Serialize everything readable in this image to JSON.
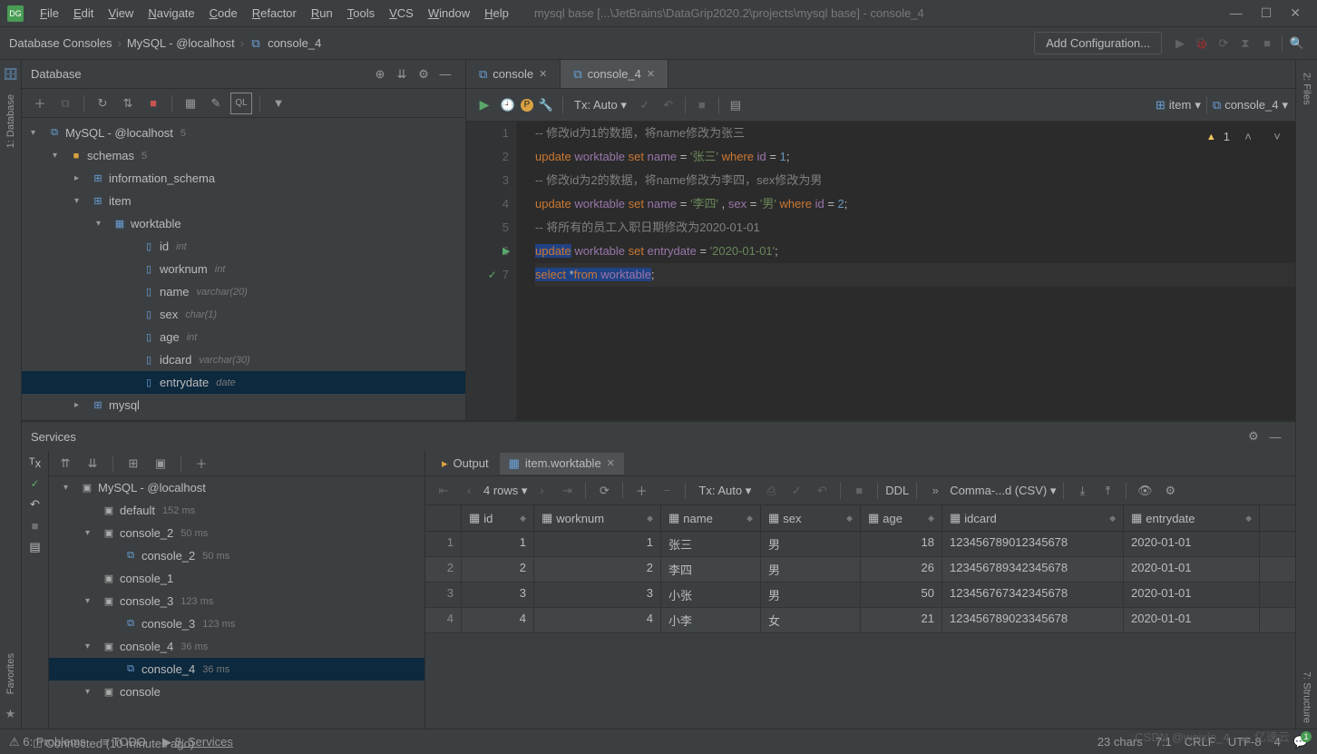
{
  "app_icon": "DG",
  "menu": [
    "File",
    "Edit",
    "View",
    "Navigate",
    "Code",
    "Refactor",
    "Run",
    "Tools",
    "VCS",
    "Window",
    "Help"
  ],
  "title_path": "mysql base [...\\JetBrains\\DataGrip2020.2\\projects\\mysql base] - console_4",
  "breadcrumb": [
    "Database Consoles",
    "MySQL - @localhost",
    "console_4"
  ],
  "config_button": "Add Configuration...",
  "db_panel": {
    "title": "Database"
  },
  "tree": {
    "root": {
      "label": "MySQL - @localhost",
      "badge": "5"
    },
    "schemas": {
      "label": "schemas",
      "badge": "5"
    },
    "info_schema": "information_schema",
    "item": "item",
    "worktable": "worktable",
    "columns": [
      {
        "name": "id",
        "type": "int"
      },
      {
        "name": "worknum",
        "type": "int"
      },
      {
        "name": "name",
        "type": "varchar(20)"
      },
      {
        "name": "sex",
        "type": "char(1)"
      },
      {
        "name": "age",
        "type": "int"
      },
      {
        "name": "idcard",
        "type": "varchar(30)"
      },
      {
        "name": "entrydate",
        "type": "date"
      }
    ],
    "mysql": "mysql"
  },
  "tabs": [
    {
      "label": "console"
    },
    {
      "label": "console_4",
      "active": true
    }
  ],
  "editor_toolbar": {
    "tx": "Tx: Auto",
    "item": "item",
    "console": "console_4"
  },
  "code_lines": [
    {
      "n": 1,
      "html": "<span class='c-comment'>-- 修改id为1的数据，将name修改为张三</span>"
    },
    {
      "n": 2,
      "html": "<span class='c-kw'>update</span> <span class='c-id'>worktable</span> <span class='c-kw'>set</span> <span class='c-id'>name</span> <span class='c-op'>=</span> <span class='c-str'>'张三'</span> <span class='c-kw'>where</span> <span class='c-id'>id</span> <span class='c-op'>=</span> <span class='c-num'>1</span><span class='c-op'>;</span>"
    },
    {
      "n": 3,
      "html": "<span class='c-comment'>-- 修改id为2的数据，将name修改为李四，sex修改为男</span>"
    },
    {
      "n": 4,
      "html": "<span class='c-kw'>update</span> <span class='c-id'>worktable</span> <span class='c-kw'>set</span> <span class='c-id'>name</span> <span class='c-op'>=</span> <span class='c-str'>'李四'</span> <span class='c-op'>,</span> <span class='c-id'>sex</span> <span class='c-op'>=</span> <span class='c-str'>'男'</span> <span class='c-kw'>where</span> <span class='c-id'>id</span> <span class='c-op'>=</span> <span class='c-num'>2</span><span class='c-op'>;</span>"
    },
    {
      "n": 5,
      "html": "<span class='c-comment'>-- 将所有的员工入职日期修改为2020-01-01</span>"
    },
    {
      "n": 6,
      "html": "<span class='c-kw' style='background:#214283;'>update</span> <span class='c-id'>worktable</span> <span class='c-kw'>set</span> <span class='c-id'>entrydate</span> <span class='c-op'>=</span> <span class='c-str'>'2020-01-01'</span><span class='c-op'>;</span>"
    },
    {
      "n": 7,
      "html": "<span class='hl-bg'><span class='c-kw'>select</span> <span class='c-op'>*</span><span class='c-kw'>from</span> <span class='c-id'>worktable</span></span><span class='c-op'>;</span>"
    }
  ],
  "warn_count": "1",
  "services": {
    "title": "Services",
    "tree": [
      {
        "label": "MySQL - @localhost",
        "indent": 0,
        "exp": "▾"
      },
      {
        "label": "default",
        "time": "152 ms",
        "indent": 1
      },
      {
        "label": "console_2",
        "time": "50 ms",
        "indent": 1,
        "exp": "▾"
      },
      {
        "label": "console_2",
        "time": "50 ms",
        "indent": 2,
        "leaf": true
      },
      {
        "label": "console_1",
        "indent": 1
      },
      {
        "label": "console_3",
        "time": "123 ms",
        "indent": 1,
        "exp": "▾"
      },
      {
        "label": "console_3",
        "time": "123 ms",
        "indent": 2,
        "leaf": true
      },
      {
        "label": "console_4",
        "time": "36 ms",
        "indent": 1,
        "exp": "▾"
      },
      {
        "label": "console_4",
        "time": "36 ms",
        "indent": 2,
        "leaf": true,
        "selected": true
      },
      {
        "label": "console",
        "indent": 1,
        "exp": "▾"
      }
    ],
    "output_tab": "Output",
    "table_tab": "item.worktable",
    "rows_label": "4 rows",
    "tx": "Tx: Auto",
    "ddl": "DDL",
    "export": "Comma-...d (CSV)"
  },
  "result": {
    "headers": [
      "id",
      "worknum",
      "name",
      "sex",
      "age",
      "idcard",
      "entrydate"
    ],
    "rows": [
      {
        "n": 1,
        "id": "1",
        "worknum": "1",
        "name": "张三",
        "sex": "男",
        "age": "18",
        "idcard": "123456789012345678",
        "entrydate": "2020-01-01"
      },
      {
        "n": 2,
        "id": "2",
        "worknum": "2",
        "name": "李四",
        "sex": "男",
        "age": "26",
        "idcard": "123456789342345678",
        "entrydate": "2020-01-01"
      },
      {
        "n": 3,
        "id": "3",
        "worknum": "3",
        "name": "小张",
        "sex": "男",
        "age": "50",
        "idcard": "123456767342345678",
        "entrydate": "2020-01-01"
      },
      {
        "n": 4,
        "id": "4",
        "worknum": "4",
        "name": "小李",
        "sex": "女",
        "age": "21",
        "idcard": "123456789023345678",
        "entrydate": "2020-01-01"
      }
    ]
  },
  "status": {
    "problems": "6: Problems",
    "todo": "TODO",
    "services": "8: Services",
    "connected": "Connected (10 minutes ago)",
    "chars": "23 chars",
    "pos": "7:1",
    "crlf": "CRLF",
    "enc": "UTF-8",
    "spaces": "4"
  },
  "left_stripe": [
    "1: Database"
  ],
  "right_stripe_top": "2: Files",
  "right_stripe_bottom": "7: Structure",
  "left_stripe_bottom": "Favorites",
  "watermark": "CSDN @weixin_4",
  "watermark2": "亿速云"
}
